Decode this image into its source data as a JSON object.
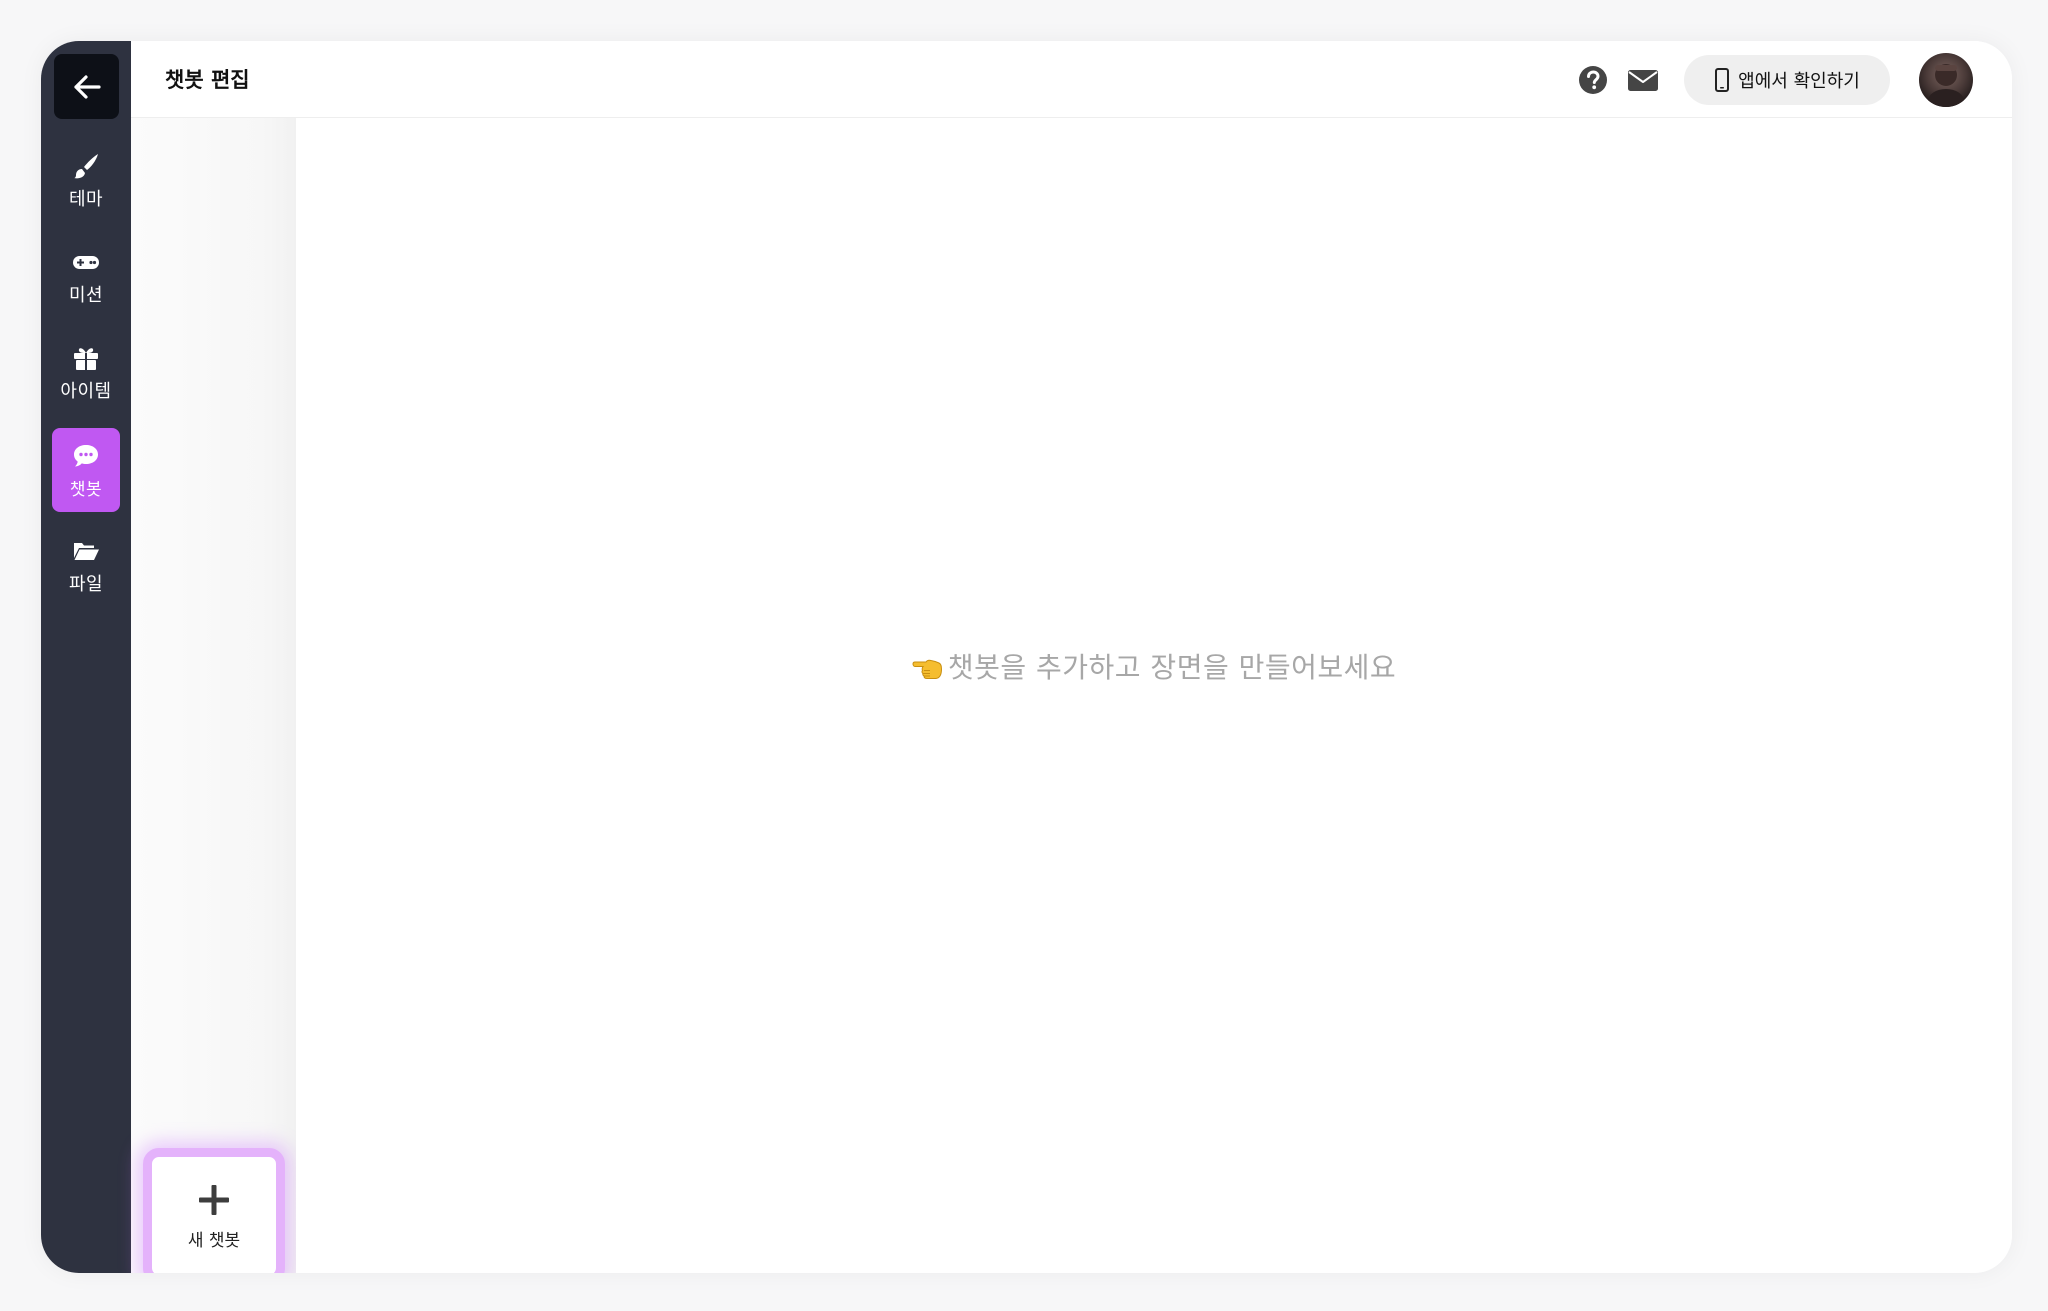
{
  "header": {
    "title": "챗봇 편집",
    "app_check_label": "앱에서 확인하기"
  },
  "nav": {
    "items": [
      {
        "label": "테마",
        "icon": "paintbrush-icon"
      },
      {
        "label": "미션",
        "icon": "gamepad-icon"
      },
      {
        "label": "아이템",
        "icon": "gift-icon"
      },
      {
        "label": "챗봇",
        "icon": "chat-bubble-icon",
        "active": true
      },
      {
        "label": "파일",
        "icon": "folder-open-icon"
      }
    ]
  },
  "list": {
    "new_button_label": "새 챗봇"
  },
  "canvas": {
    "empty_message": "챗봇을 추가하고 장면을 만들어보세요"
  },
  "colors": {
    "rail": "#2e3240",
    "accent": "#c058f2",
    "accent_glow": "#e4b2fb"
  }
}
